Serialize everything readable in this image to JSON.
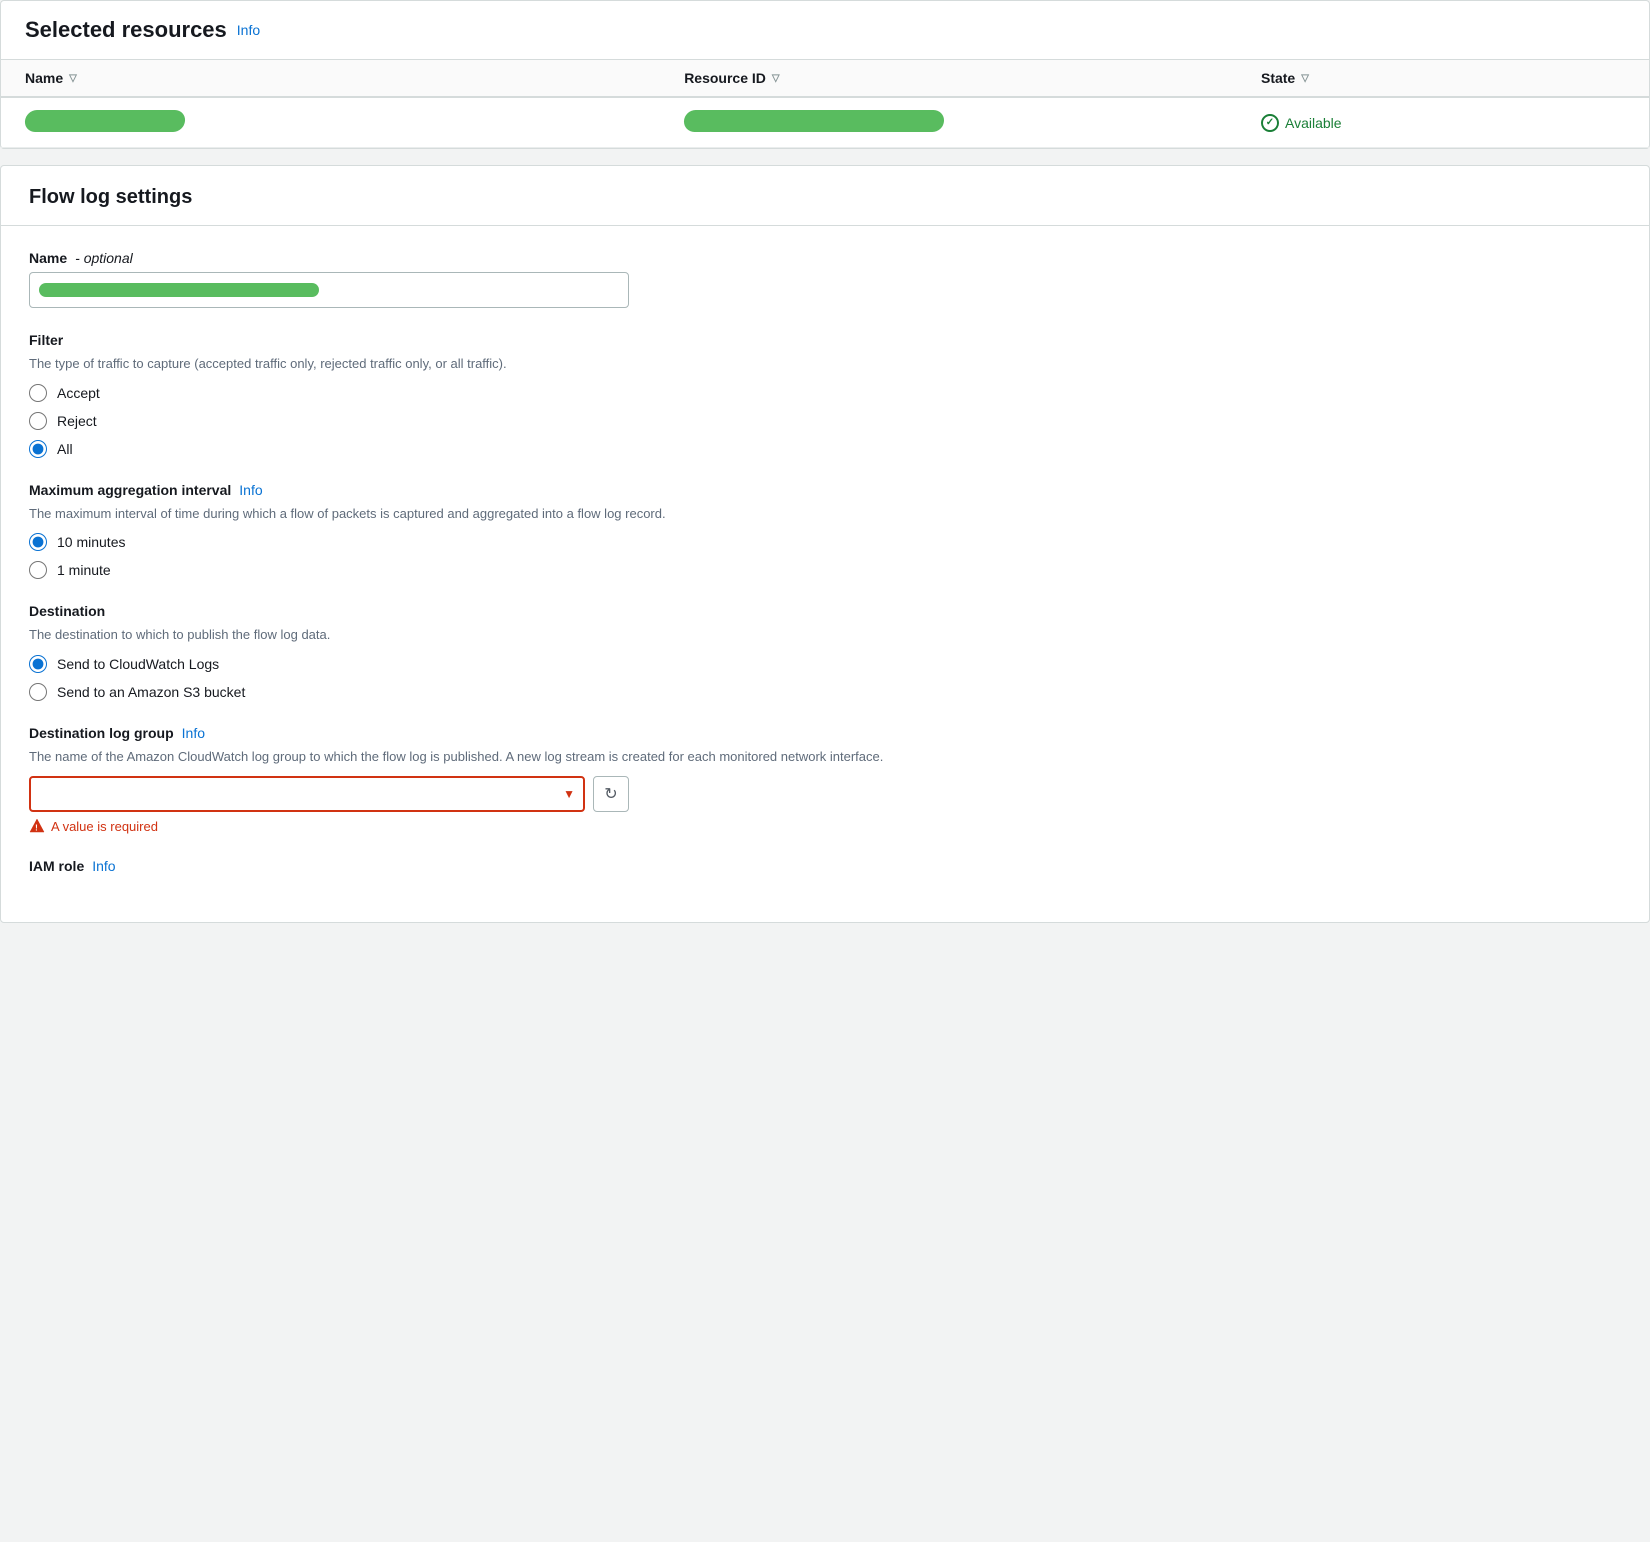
{
  "selectedResources": {
    "title": "Selected resources",
    "infoLink": "Info",
    "table": {
      "columns": [
        {
          "key": "name",
          "label": "Name"
        },
        {
          "key": "resourceId",
          "label": "Resource ID"
        },
        {
          "key": "state",
          "label": "State"
        }
      ],
      "rows": [
        {
          "name": "[redacted]",
          "resourceId": "[redacted]",
          "state": "Available"
        }
      ]
    }
  },
  "flowLogSettings": {
    "title": "Flow log settings",
    "nameField": {
      "label": "Name",
      "optional": "optional",
      "placeholder": "",
      "value": ""
    },
    "filter": {
      "label": "Filter",
      "description": "The type of traffic to capture (accepted traffic only, rejected traffic only, or all traffic).",
      "options": [
        {
          "value": "accept",
          "label": "Accept",
          "selected": false
        },
        {
          "value": "reject",
          "label": "Reject",
          "selected": false
        },
        {
          "value": "all",
          "label": "All",
          "selected": true
        }
      ]
    },
    "maxAggregationInterval": {
      "label": "Maximum aggregation interval",
      "infoLink": "Info",
      "description": "The maximum interval of time during which a flow of packets is captured and aggregated into a flow log record.",
      "options": [
        {
          "value": "10min",
          "label": "10 minutes",
          "selected": true
        },
        {
          "value": "1min",
          "label": "1 minute",
          "selected": false
        }
      ]
    },
    "destination": {
      "label": "Destination",
      "description": "The destination to which to publish the flow log data.",
      "options": [
        {
          "value": "cloudwatch",
          "label": "Send to CloudWatch Logs",
          "selected": true
        },
        {
          "value": "s3",
          "label": "Send to an Amazon S3 bucket",
          "selected": false
        }
      ]
    },
    "destinationLogGroup": {
      "label": "Destination log group",
      "infoLink": "Info",
      "description": "The name of the Amazon CloudWatch log group to which the flow log is published. A new log stream is created for each monitored network interface.",
      "placeholder": "",
      "value": "",
      "errorMessage": "A value is required"
    },
    "iamRole": {
      "label": "IAM role",
      "infoLink": "Info"
    }
  },
  "icons": {
    "sortTriangle": "▽",
    "checkmark": "✓",
    "dropdownArrow": "▼",
    "refresh": "↻",
    "warning": "⚠"
  }
}
